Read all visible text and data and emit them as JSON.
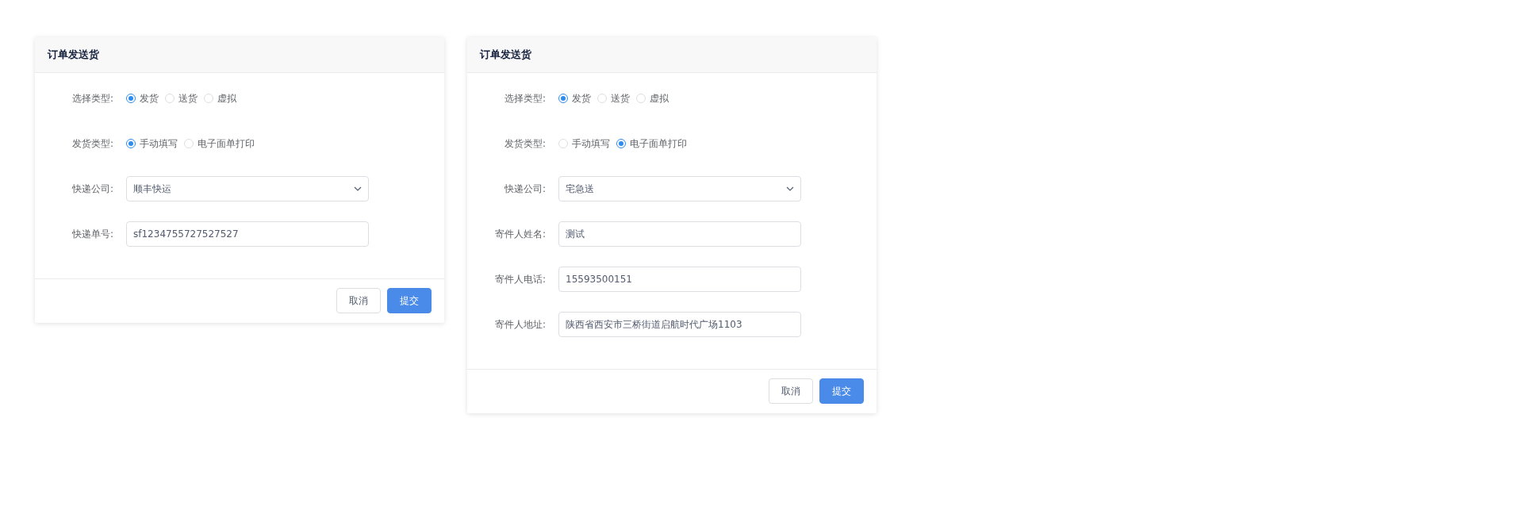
{
  "dialogs": [
    {
      "title": "订单发送货",
      "fields": [
        {
          "kind": "radio",
          "label": "选择类型:",
          "options": [
            {
              "label": "发货",
              "selected": true
            },
            {
              "label": "送货",
              "selected": false
            },
            {
              "label": "虚拟",
              "selected": false
            }
          ]
        },
        {
          "kind": "radio",
          "label": "发货类型:",
          "options": [
            {
              "label": "手动填写",
              "selected": true
            },
            {
              "label": "电子面单打印",
              "selected": false
            }
          ]
        },
        {
          "kind": "select",
          "label": "快递公司:",
          "value": "顺丰快运"
        },
        {
          "kind": "input",
          "label": "快递单号:",
          "value": "sf1234755727527527"
        }
      ],
      "buttons": [
        {
          "kind": "default",
          "label": "取消"
        },
        {
          "kind": "primary",
          "label": "提交"
        }
      ]
    },
    {
      "title": "订单发送货",
      "fields": [
        {
          "kind": "radio",
          "label": "选择类型:",
          "options": [
            {
              "label": "发货",
              "selected": true
            },
            {
              "label": "送货",
              "selected": false
            },
            {
              "label": "虚拟",
              "selected": false
            }
          ]
        },
        {
          "kind": "radio",
          "label": "发货类型:",
          "options": [
            {
              "label": "手动填写",
              "selected": false
            },
            {
              "label": "电子面单打印",
              "selected": true
            }
          ]
        },
        {
          "kind": "select",
          "label": "快递公司:",
          "value": "宅急送"
        },
        {
          "kind": "input",
          "label": "寄件人姓名:",
          "value": "测试"
        },
        {
          "kind": "input",
          "label": "寄件人电话:",
          "value": "15593500151"
        },
        {
          "kind": "input",
          "label": "寄件人地址:",
          "value": "陕西省西安市三桥街道启航时代广场1103"
        }
      ],
      "buttons": [
        {
          "kind": "default",
          "label": "取消"
        },
        {
          "kind": "primary",
          "label": "提交"
        }
      ]
    }
  ]
}
